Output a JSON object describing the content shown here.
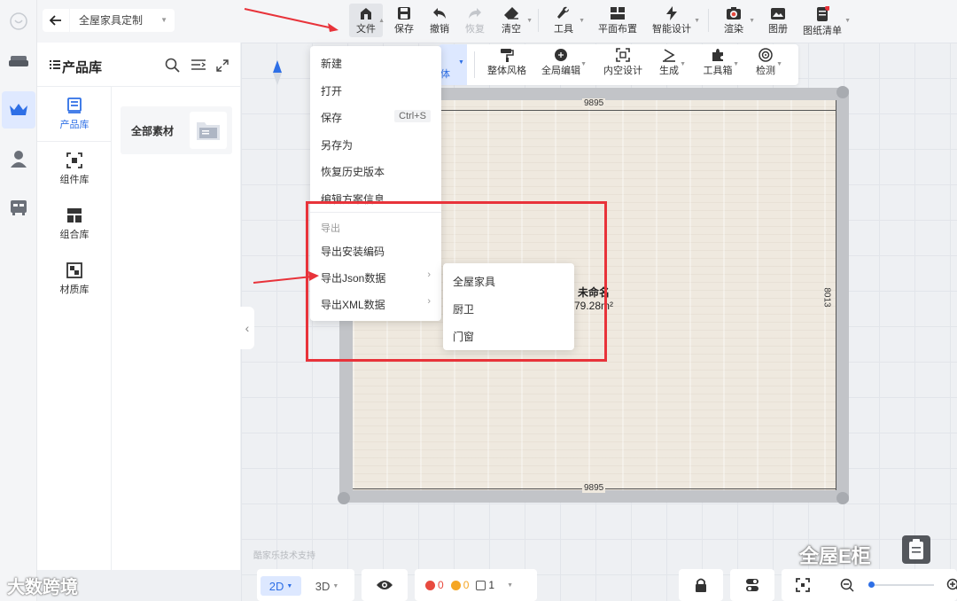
{
  "topbar": {
    "project_name": "全屋家具定制",
    "tools": {
      "file": "文件",
      "save": "保存",
      "undo": "撤销",
      "redo": "恢复",
      "clear": "清空",
      "tools": "工具",
      "floor_plan": "平面布置",
      "smart_design": "智能设计",
      "render": "渲染",
      "album": "图册",
      "drawing_list": "图纸清单"
    }
  },
  "panel": {
    "title": "产品库",
    "tabs": [
      "产品库",
      "组件库",
      "组合库",
      "材质库"
    ],
    "all_materials": "全部素材"
  },
  "subbar": {
    "partial_label": "体",
    "items": [
      "整体风格",
      "全局编辑",
      "内空设计",
      "生成",
      "工具箱",
      "检测"
    ]
  },
  "file_menu": {
    "items": [
      "新建",
      "打开",
      "保存",
      "另存为",
      "恢复历史版本",
      "编辑方案信息"
    ],
    "save_shortcut": "Ctrl+S",
    "export_group": "导出",
    "export_items": [
      "导出安装编码",
      "导出Json数据",
      "导出XML数据"
    ]
  },
  "json_submenu": [
    "全屋家具",
    "厨卫",
    "门窗"
  ],
  "room": {
    "name": "未命名",
    "area": "79.28m²",
    "width_top": "9895",
    "width_bottom": "9895",
    "height_right": "8013"
  },
  "bottom": {
    "view_2d": "2D",
    "view_3d": "3D",
    "error_count": "0",
    "warning_count": "0",
    "layer_count": "1",
    "credit": "酷家乐技术支持"
  },
  "watermarks": {
    "left": "大数跨境",
    "right": "全屋E柜"
  },
  "colors": {
    "accent": "#2e6fe6",
    "annotation_red": "#e8333a",
    "error": "#e84a3f",
    "warning": "#f5a623"
  }
}
